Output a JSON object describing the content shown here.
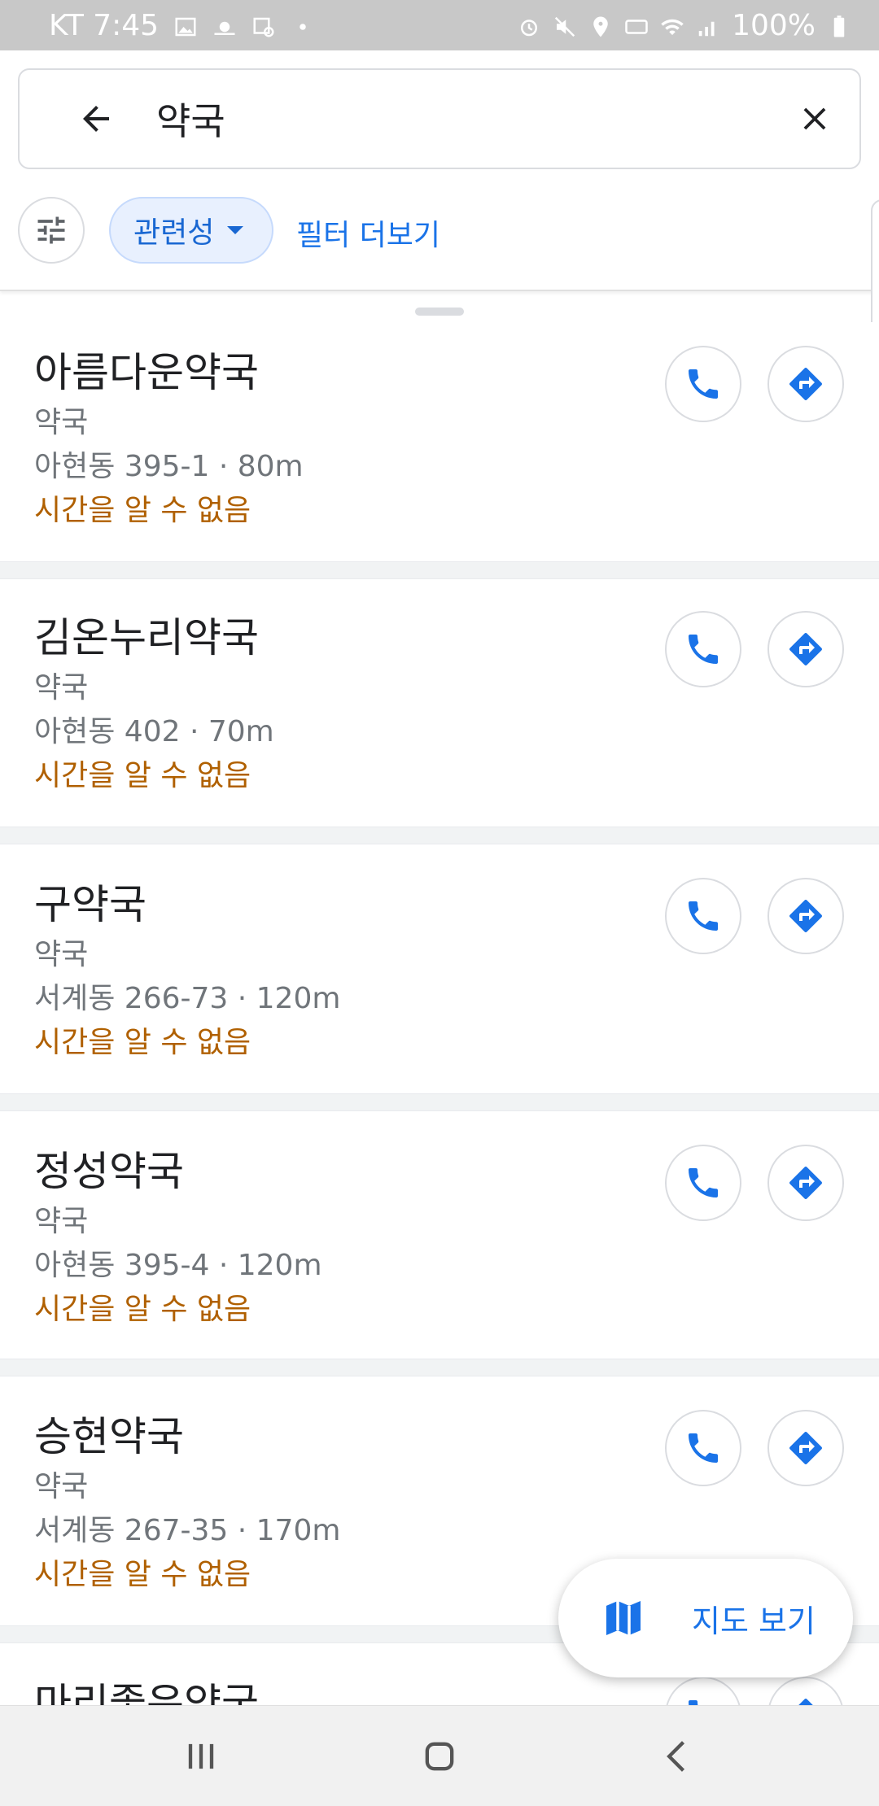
{
  "status_bar": {
    "carrier_time": "KT 7:45",
    "battery": "100%",
    "left_icons": [
      "gallery-icon",
      "weather-icon",
      "screenshot-icon",
      "dot-icon"
    ],
    "right_icons": [
      "alarm-icon",
      "mute-icon",
      "location-icon",
      "hd-icon",
      "wifi-icon",
      "signal-icon",
      "battery-icon"
    ]
  },
  "search": {
    "query": "약국"
  },
  "filters": {
    "relevance_chip": "관련성",
    "more_filters": "필터 더보기"
  },
  "results": [
    {
      "name": "아름다운약국",
      "category": "약국",
      "address": "아현동 395-1 · 80m",
      "hours": "시간을 알 수 없음"
    },
    {
      "name": "김온누리약국",
      "category": "약국",
      "address": "아현동 402 · 70m",
      "hours": "시간을 알 수 없음"
    },
    {
      "name": "구약국",
      "category": "약국",
      "address": "서계동 266-73 · 120m",
      "hours": "시간을 알 수 없음"
    },
    {
      "name": "정성약국",
      "category": "약국",
      "address": "아현동 395-4 · 120m",
      "hours": "시간을 알 수 없음"
    },
    {
      "name": "승현약국",
      "category": "약국",
      "address": "서계동 267-35 · 170m",
      "hours": "시간을 알 수 없음"
    },
    {
      "name": "마리좋은약국"
    }
  ],
  "map_button": {
    "label": "지도 보기"
  },
  "colors": {
    "accent_blue": "#1a73e8",
    "hours_orange": "#b06000",
    "secondary_text": "#70757a"
  }
}
